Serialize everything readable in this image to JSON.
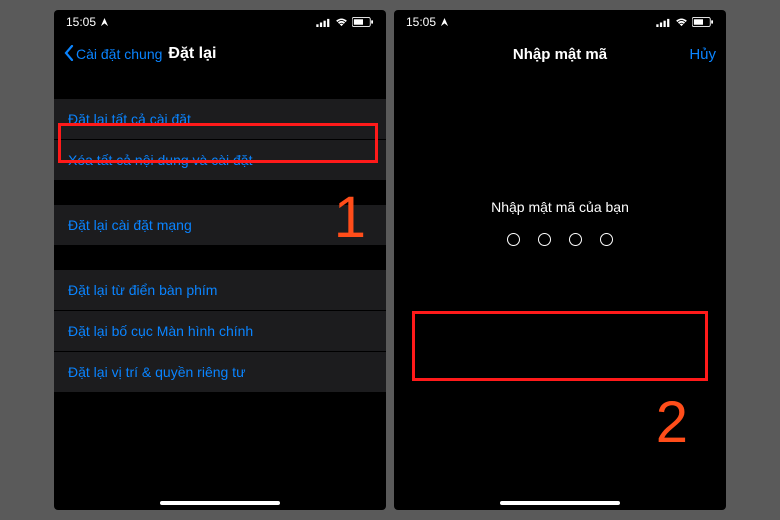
{
  "statusbar": {
    "time": "15:05"
  },
  "left_phone": {
    "back_label": "Cài đặt chung",
    "title": "Đặt lại",
    "sections": [
      [
        "Đặt lại tất cả cài đặt",
        "Xóa tất cả nội dung và cài đặt"
      ],
      [
        "Đặt lại cài đặt mạng"
      ],
      [
        "Đặt lại từ điển bàn phím",
        "Đặt lại bố cục Màn hình chính",
        "Đặt lại vị trí & quyền riêng tư"
      ]
    ],
    "step": "1"
  },
  "right_phone": {
    "title": "Nhập mật mã",
    "cancel": "Hủy",
    "prompt": "Nhập mật mã của bạn",
    "step": "2"
  }
}
